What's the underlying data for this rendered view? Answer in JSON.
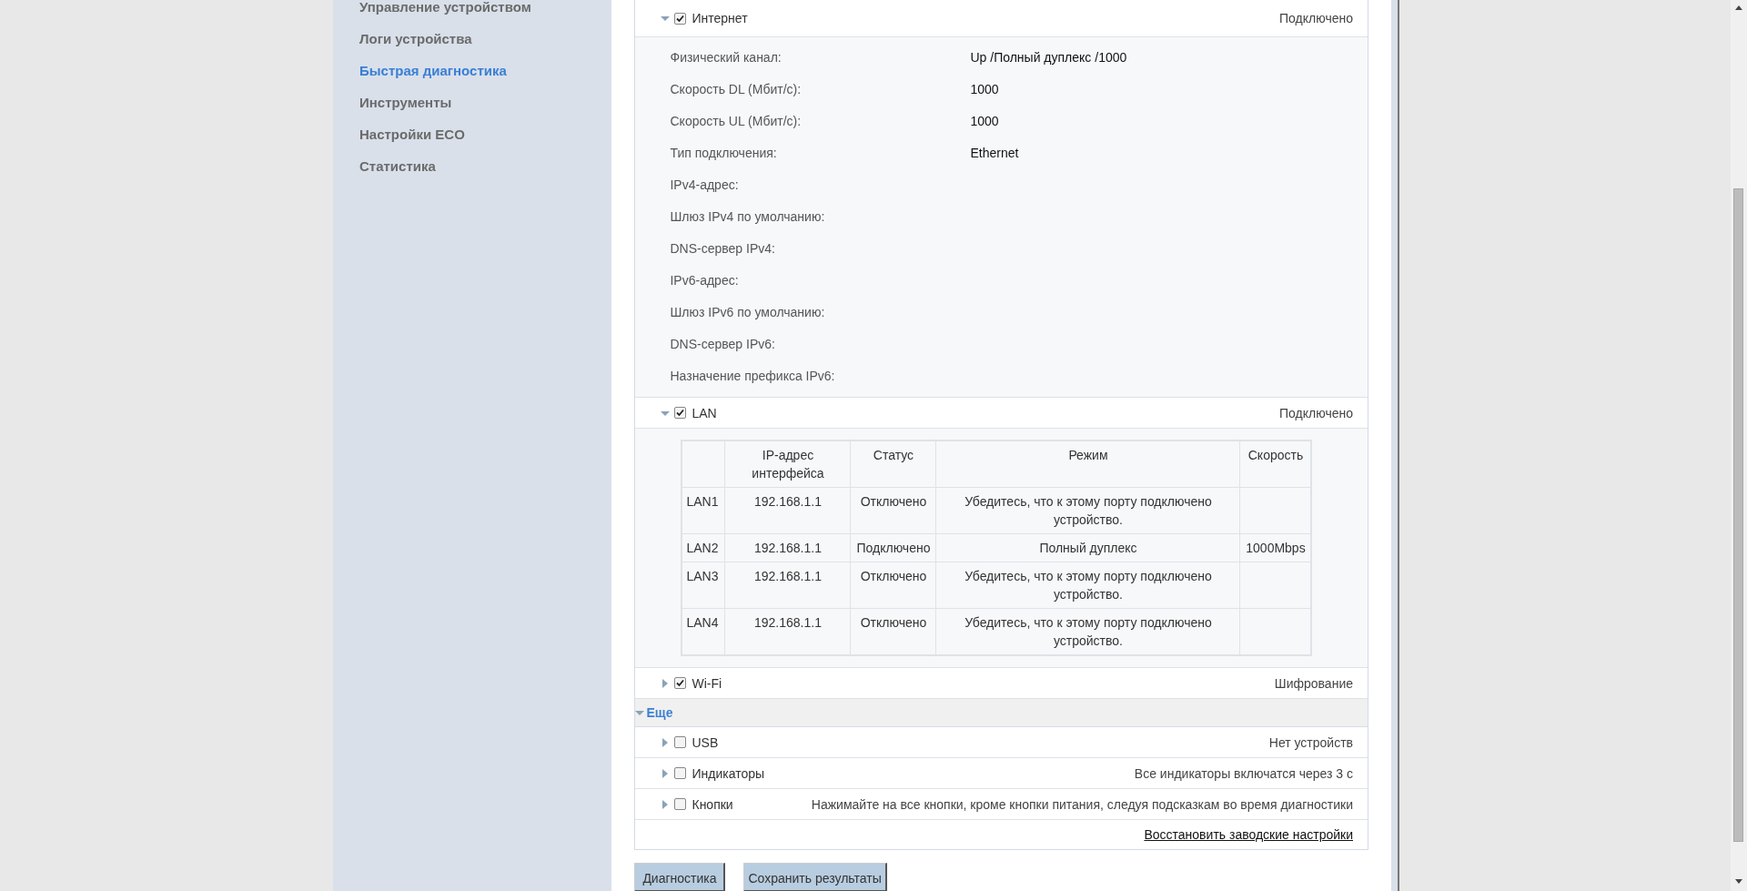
{
  "sidebar": {
    "items": [
      {
        "label": "Управление устройством",
        "selected": false
      },
      {
        "label": "Логи устройства",
        "selected": false
      },
      {
        "label": "Быстрая диагностика",
        "selected": true
      },
      {
        "label": "Инструменты",
        "selected": false
      },
      {
        "label": "Настройки ECO",
        "selected": false
      },
      {
        "label": "Статистика",
        "selected": false
      }
    ]
  },
  "sections": [
    {
      "kind": "fields",
      "title": "Интернет",
      "checked": true,
      "expanded": true,
      "status": "Подключено",
      "fields": [
        {
          "label": "Физический канал:",
          "value": "Up /Полный дуплекс /1000"
        },
        {
          "label": "Скорость DL (Мбит/с):",
          "value": "1000"
        },
        {
          "label": "Скорость UL (Мбит/с):",
          "value": "1000"
        },
        {
          "label": "Тип подключения:",
          "value": "Ethernet"
        },
        {
          "label": "IPv4-адрес:"
        },
        {
          "label": "Шлюз IPv4 по умолчанию:"
        },
        {
          "label": "DNS-сервер IPv4:"
        },
        {
          "label": "IPv6-адрес:"
        },
        {
          "label": "Шлюз IPv6 по умолчанию:"
        },
        {
          "label": "DNS-сервер IPv6:"
        },
        {
          "label": "Назначение префикса IPv6:"
        }
      ]
    },
    {
      "kind": "table",
      "title": "LAN",
      "checked": true,
      "expanded": true,
      "status": "Подключено",
      "table": {
        "columns": [
          "",
          "IP-адрес интерфейса",
          "Статус",
          "Режим",
          "Скорость"
        ],
        "rows": [
          [
            "LAN1",
            "192.168.1.1",
            "Отключено",
            "Убедитесь, что к этому порту подключено устройство.",
            ""
          ],
          [
            "LAN2",
            "192.168.1.1",
            "Подключено",
            "Полный дуплекс",
            "1000Mbps"
          ],
          [
            "LAN3",
            "192.168.1.1",
            "Отключено",
            "Убедитесь, что к этому порту подключено устройство.",
            ""
          ],
          [
            "LAN4",
            "192.168.1.1",
            "Отключено",
            "Убедитесь, что к этому порту подключено устройство.",
            ""
          ]
        ]
      }
    },
    {
      "title": "Wi-Fi",
      "checked": true,
      "expanded": false,
      "status": "Шифрование"
    }
  ],
  "more": {
    "title": "Еще",
    "expanded": true
  },
  "more_items": [
    {
      "title": "USB",
      "checked": false,
      "expanded": false,
      "status": "Нет устройств"
    },
    {
      "title": "Индикаторы",
      "checked": false,
      "expanded": false,
      "status": "Все индикаторы включатся через 3 с"
    },
    {
      "title": "Кнопки",
      "checked": false,
      "expanded": false,
      "status": "Нажимайте на все кнопки, кроме кнопки питания, следуя подсказкам во время диагностики"
    }
  ],
  "restore_link": "Восстановить заводские настройки",
  "buttons": [
    "Диагностика",
    "Сохранить результаты"
  ]
}
